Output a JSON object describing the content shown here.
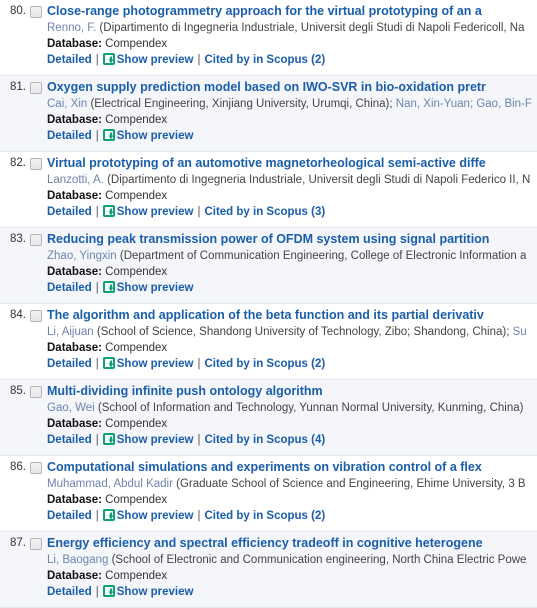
{
  "list": {
    "database_label": "Database:",
    "detailed_label": "Detailed",
    "show_preview_label": "Show preview",
    "separator": "|",
    "preview_icon": "preview-download-icon",
    "colors": {
      "title_link": "#1a5eab",
      "author_link": "#6c85ad",
      "preview_icon": "#12a07a",
      "alt_row_background": "#f4f6fa",
      "row_border": "#e3e7ee"
    },
    "results": [
      {
        "index": "80.",
        "title": "Close-range photogrammetry approach for the virtual prototyping of an a",
        "author_link": "Renno, F.",
        "author_affiliation": " (Dipartimento di Ingegneria Industriale, Universit degli Studi di Napoli Federicoll, Na",
        "database": "Compendex",
        "cited_by": "Cited by in Scopus (2)",
        "has_cited_by": true
      },
      {
        "index": "81.",
        "title": "Oxygen supply prediction model based on IWO-SVR in bio-oxidation pretr",
        "author_link": "Cai, Xin",
        "author_affiliation": " (Electrical Engineering, Xinjiang University, Urumqi, China); ",
        "author_tail": "Nan, Xin-Yuan; Gao, Bin-F",
        "database": "Compendex",
        "cited_by": "",
        "has_cited_by": false
      },
      {
        "index": "82.",
        "title": "Virtual prototyping of an automotive magnetorheological semi-active diffe",
        "author_link": "Lanzotti, A.",
        "author_affiliation": " (Dipartimento di Ingegneria Industriale, Universit degli Studi di Napoli Federico II, N",
        "database": "Compendex",
        "cited_by": "Cited by in Scopus (3)",
        "has_cited_by": true
      },
      {
        "index": "83.",
        "title": "Reducing peak transmission power of OFDM system using signal partition",
        "author_link": "Zhao, Yingxin",
        "author_affiliation": " (Department of Communication Engineering, College of Electronic Information a",
        "database": "Compendex",
        "cited_by": "",
        "has_cited_by": false
      },
      {
        "index": "84.",
        "title": "The algorithm and application of the beta function and its partial derivativ",
        "author_link": "Li, Aijuan",
        "author_affiliation": " (School of Science, Shandong University of Technology, Zibo; Shandong, China); ",
        "author_tail": "Su",
        "database": "Compendex",
        "cited_by": "Cited by in Scopus (2)",
        "has_cited_by": true
      },
      {
        "index": "85.",
        "title": "Multi-dividing infinite push ontology algorithm",
        "author_link": "Gao, Wei",
        "author_affiliation": " (School of Information and Technology, Yunnan Normal University, Kunming, China)",
        "database": "Compendex",
        "cited_by": "Cited by in Scopus (4)",
        "has_cited_by": true
      },
      {
        "index": "86.",
        "title": "Computational simulations and experiments on vibration control of a flex",
        "author_link": "Muhammad, Abdul Kadir",
        "author_affiliation": " (Graduate School of Science and Engineering, Ehime University, 3 B",
        "database": "Compendex",
        "cited_by": "Cited by in Scopus (2)",
        "has_cited_by": true
      },
      {
        "index": "87.",
        "title": "Energy efficiency and spectral efficiency tradeoff in cognitive heterogene",
        "author_link": "Li, Baogang",
        "author_affiliation": " (School of Electronic and Communication engineering, North China Electric Powe",
        "database": "Compendex",
        "cited_by": "",
        "has_cited_by": false
      }
    ]
  }
}
